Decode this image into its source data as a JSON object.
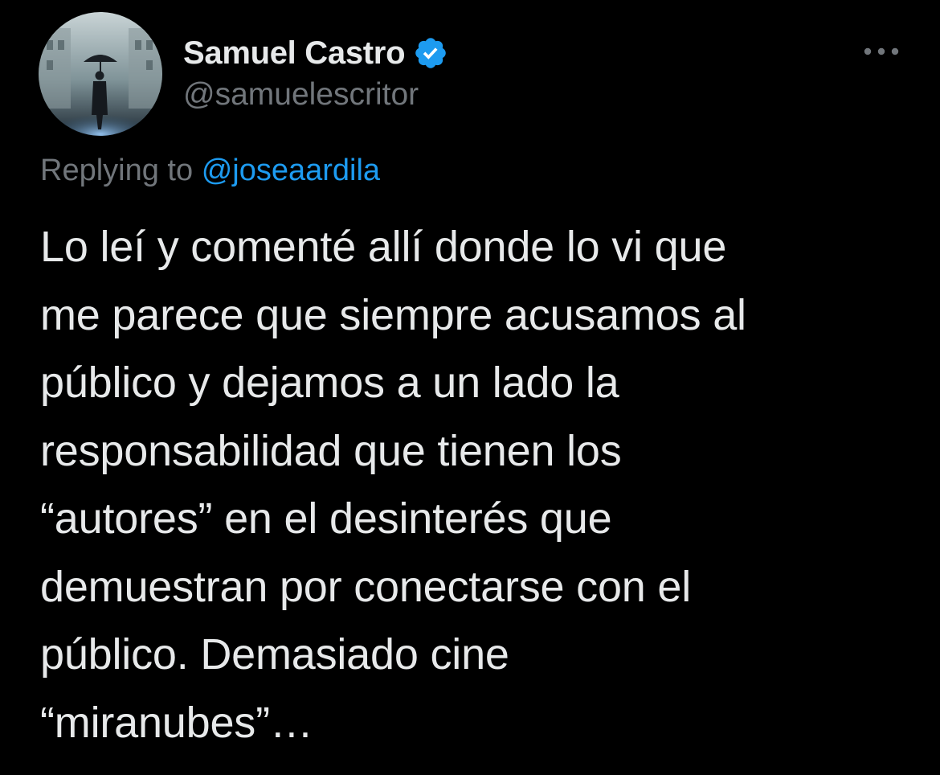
{
  "tweet": {
    "author": {
      "display_name": "Samuel Castro",
      "handle": "@samuelescritor",
      "verified": true,
      "avatar_icon": "avatar-photo-figure-with-umbrella"
    },
    "more_icon": "more-options-icon",
    "reply_prefix": "Replying to",
    "reply_to": "@joseaardila",
    "text": "Lo leí y comenté allí donde lo vi que\nme parece que siempre acusamos al\npúblico y dejamos a un lado la\nresponsabilidad que tienen los\n“autores” en el desinterés que\ndemuestran por conectarse con el\npúblico. Demasiado cine\n“miranubes”…"
  },
  "colors": {
    "background": "#000000",
    "primary_text": "#e7e9ea",
    "secondary_text": "#71767b",
    "accent": "#1d9bf0"
  }
}
